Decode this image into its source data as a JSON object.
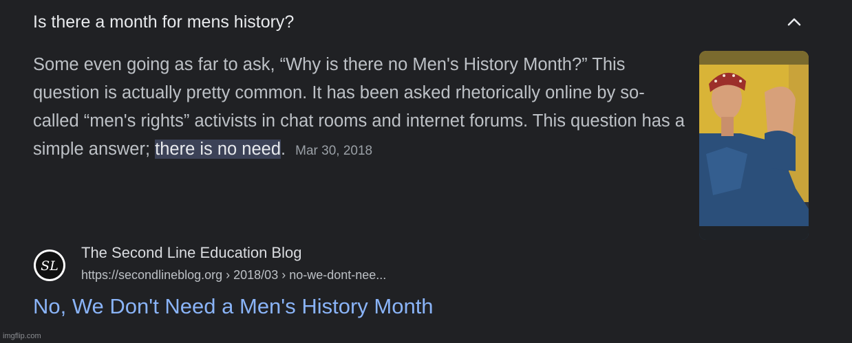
{
  "question": {
    "text": "Is there a month for mens history?",
    "toggle_icon": "chevron-up-icon"
  },
  "snippet": {
    "text_before": "Some even going as far to ask, “Why is there no Men's History Month?” This question is actually pretty common. It has been asked rhetorically online by so-called “men's rights” activists in chat rooms and internet forums. This question has a simple answer; ",
    "highlight": "there is no need",
    "text_after": ".",
    "date": "Mar 30, 2018",
    "highlight_color": "#3c4257"
  },
  "source": {
    "favicon_text": "SL",
    "name": "The Second Line Education Blog",
    "url": "https://secondlineblog.org › 2018/03 › no-we-dont-nee..."
  },
  "result": {
    "title": "No, We Don't Need a Men's History Month",
    "link_color": "#8ab4f8"
  },
  "watermark": "imgflip.com"
}
